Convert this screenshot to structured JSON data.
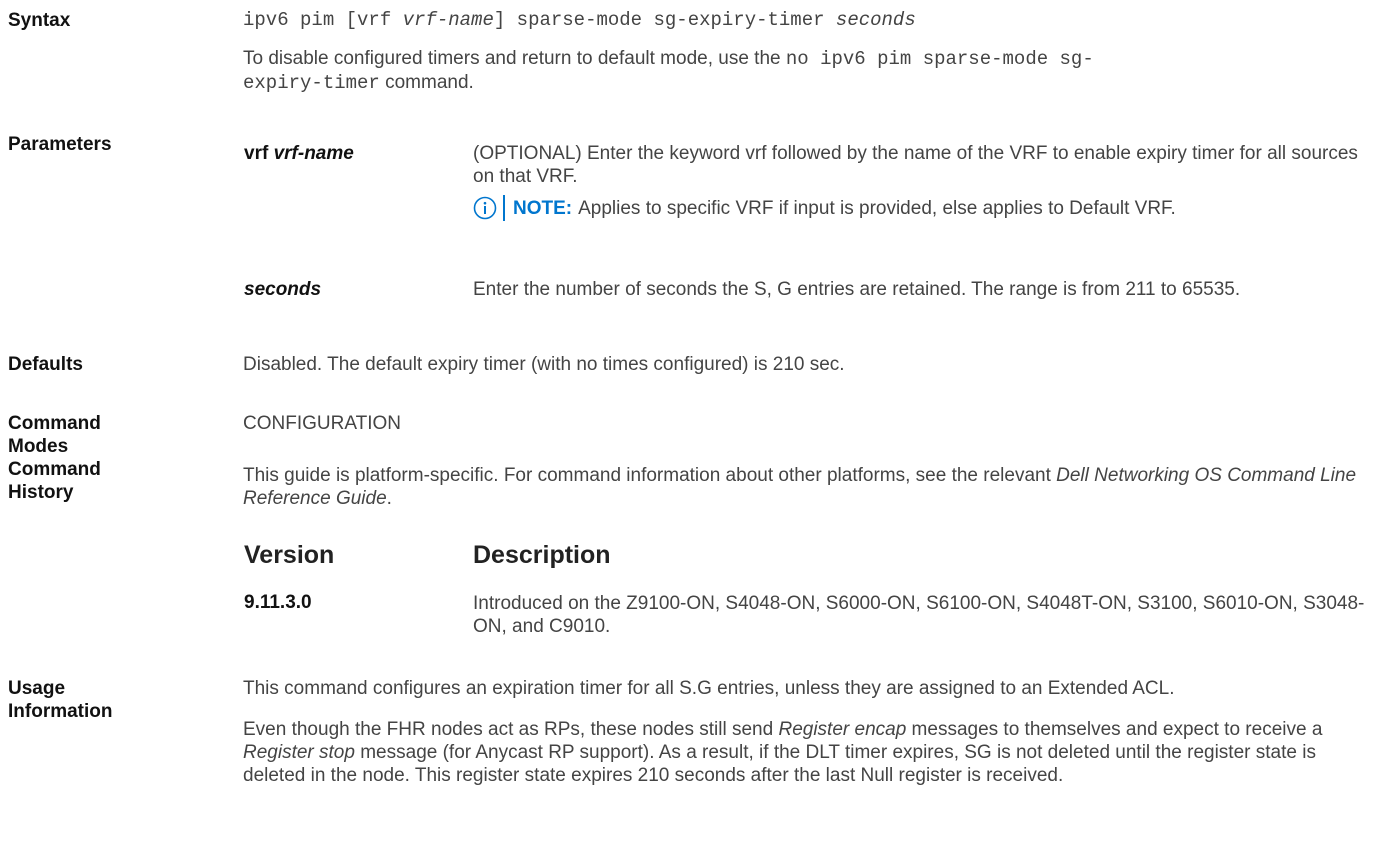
{
  "syntax": {
    "label": "Syntax",
    "cmd_part1": "ipv6 pim [vrf ",
    "cmd_vrf_name": "vrf-name",
    "cmd_part2": "] sparse-mode sg-expiry-timer ",
    "cmd_seconds": "seconds",
    "disable_text1": "To disable configured timers and return to default mode, use the ",
    "disable_cmd_a": "no ipv6 pim sparse-mode sg-",
    "disable_cmd_b": "expiry-timer",
    "disable_text2": " command."
  },
  "parameters": {
    "label": "Parameters",
    "vrf_keyword": "vrf",
    "vrf_name": "vrf-name",
    "vrf_desc": "(OPTIONAL) Enter the keyword vrf followed by the name of the VRF to enable expiry timer for all sources on that VRF.",
    "note_label": "NOTE:",
    "note_text": "Applies to specific VRF if input is provided, else applies to Default VRF.",
    "seconds_name": "seconds",
    "seconds_desc": "Enter the number of seconds the S, G entries are retained. The range is from 211 to 65535."
  },
  "defaults": {
    "label": "Defaults",
    "text": "Disabled. The default expiry timer (with no times configured) is 210 sec."
  },
  "command_modes": {
    "label": "Command Modes",
    "text": "CONFIGURATION"
  },
  "command_history": {
    "label": "Command History",
    "text_a": "This guide is platform-specific. For command information about other platforms, see the relevant ",
    "text_italic": "Dell Networking OS Command Line Reference Guide",
    "text_b": ".",
    "col_version": "Version",
    "col_description": "Description",
    "rows": [
      {
        "version": "9.11.3.0",
        "description": "Introduced on the Z9100-ON, S4048-ON, S6000-ON, S6100-ON, S4048T-ON, S3100, S6010-ON, S3048-ON, and C9010."
      }
    ]
  },
  "usage_information": {
    "label": "Usage Information",
    "para1": "This command configures an expiration timer for all S.G entries, unless they are assigned to an Extended ACL.",
    "p2_a": "Even though the FHR nodes act as RPs, these nodes still send ",
    "p2_i1": "Register encap",
    "p2_b": " messages to themselves and expect to receive a ",
    "p2_i2": "Register stop",
    "p2_c": " message (for Anycast RP support). As a result, if the DLT timer expires, SG is not deleted until the register state is deleted in the node. This register state expires 210 seconds after the last Null register is received."
  },
  "colors": {
    "text": "#444444",
    "label": "#111111",
    "note_accent": "#0076ce"
  },
  "icons": {
    "note": "info-circle-icon"
  }
}
